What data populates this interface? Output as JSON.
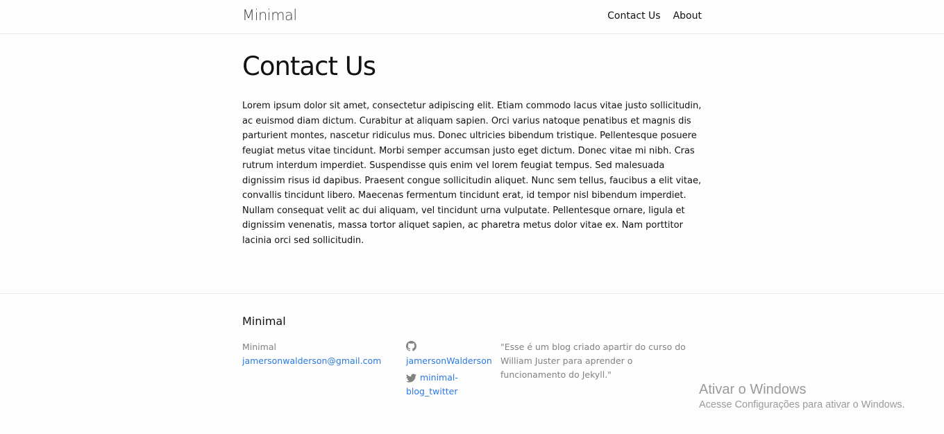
{
  "header": {
    "site_title": "Minimal",
    "nav": [
      {
        "label": "Contact Us"
      },
      {
        "label": "About"
      }
    ]
  },
  "page": {
    "title": "Contact Us",
    "body": "Lorem ipsum dolor sit amet, consectetur adipiscing elit. Etiam commodo lacus vitae justo sollicitudin, ac euismod diam dictum. Curabitur at aliquam sapien. Orci varius natoque penatibus et magnis dis parturient montes, nascetur ridiculus mus. Donec ultricies bibendum tristique. Pellentesque posuere feugiat metus vitae tincidunt. Morbi semper accumsan justo eget dictum. Donec vitae mi nibh. Cras rutrum interdum imperdiet. Suspendisse quis enim vel lorem feugiat tempus. Sed malesuada dignissim risus id dapibus. Praesent congue sollicitudin aliquet. Nunc sem tellus, faucibus a elit vitae, convallis tincidunt libero. Maecenas fermentum tincidunt erat, id tempor nisl bibendum imperdiet. Nullam consequat velit ac dui aliquam, vel tincidunt urna vulputate. Pellentesque ornare, ligula et dignissim venenatis, massa tortor aliquet sapien, ac pharetra metus dolor vitae ex. Nam porttitor lacinia orci sed sollicitudin."
  },
  "footer": {
    "heading": "Minimal",
    "name": "Minimal",
    "email": "jamersonwalderson@gmail.com",
    "github": {
      "icon": "github-icon",
      "username": "jamersonWalderson"
    },
    "twitter": {
      "icon": "twitter-icon",
      "username": "minimal-blog_twitter"
    },
    "description": "\"Esse é um blog criado apartir do curso do William Juster para aprender o funcionamento do Jekyll.\""
  },
  "os_overlay": {
    "title": "Ativar o Windows",
    "subtitle": "Acesse Configurações para ativar o Windows."
  },
  "colors": {
    "link": "#2a7ae2",
    "muted": "#828282",
    "border": "#e8e8e8",
    "background": "#fdfdfd"
  }
}
